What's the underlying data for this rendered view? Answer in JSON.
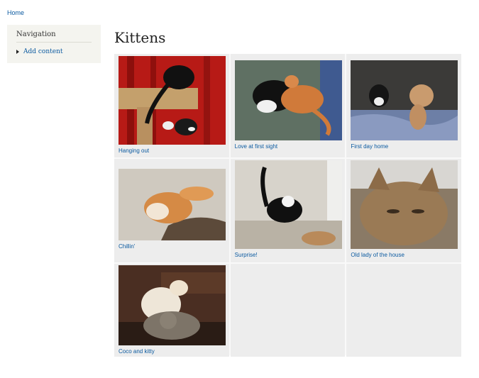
{
  "breadcrumb": {
    "home": "Home"
  },
  "sidebar": {
    "title": "Navigation",
    "items": [
      {
        "label": "Add content"
      }
    ]
  },
  "page": {
    "title": "Kittens"
  },
  "gallery": [
    {
      "caption": "Hanging out"
    },
    {
      "caption": "Love at first sight"
    },
    {
      "caption": "First day home"
    },
    {
      "caption": "Chillin'"
    },
    {
      "caption": "Surprise!"
    },
    {
      "caption": "Old lady of the house"
    },
    {
      "caption": "Coco and kitty"
    }
  ]
}
